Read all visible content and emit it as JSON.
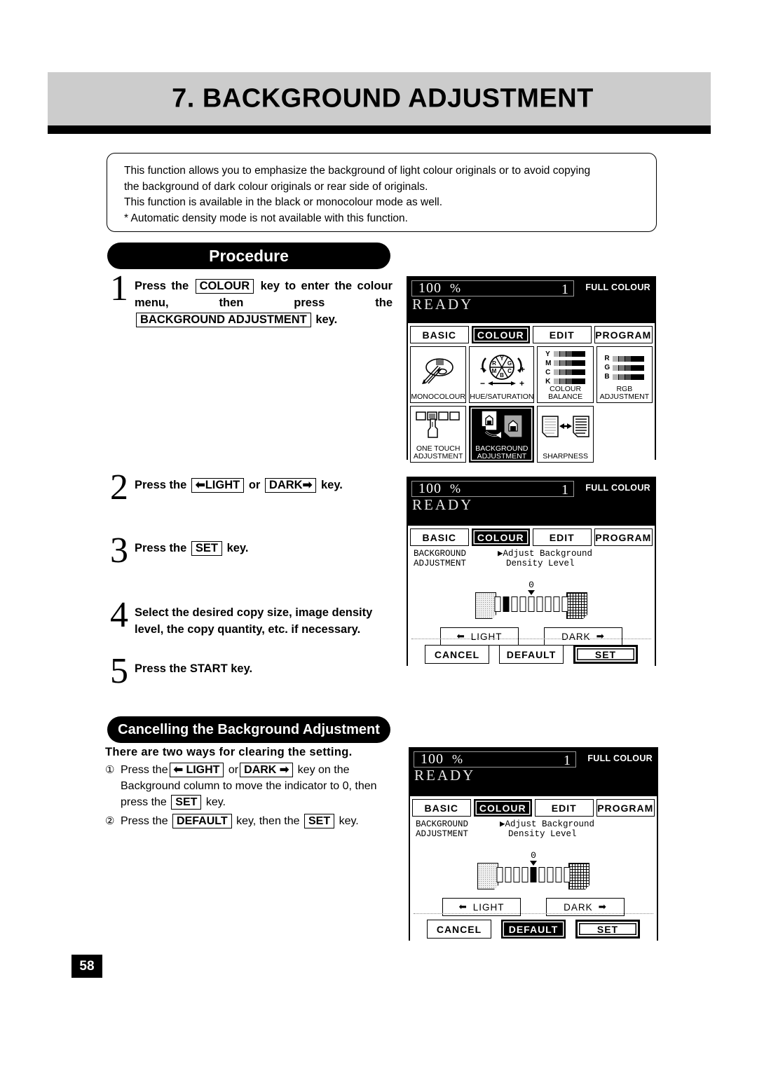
{
  "chapter": {
    "title": "7. BACKGROUND ADJUSTMENT"
  },
  "intro": {
    "line1": "This function allows you to emphasize the background of light colour originals or to avoid copying",
    "line2": "the background of dark colour originals or rear side of originals.",
    "line3": "This function is available in the black or monocolour mode as well.",
    "line4": "* Automatic density mode is not available with this function."
  },
  "headings": {
    "procedure": "Procedure",
    "cancelling": "Cancelling the Background Adjustment"
  },
  "steps": [
    {
      "num": "1",
      "part1": "Press the",
      "key1": "COLOUR",
      "part2": "key to enter the colour menu, then press the",
      "key2": "BACKGROUND ADJUSTMENT",
      "part3": "key."
    },
    {
      "num": "2",
      "part1": "Press the",
      "key1": "LIGHT",
      "part2": "or",
      "key2": "DARK",
      "part3": "key."
    },
    {
      "num": "3",
      "part1": "Press the",
      "key1": "SET",
      "part2": "key."
    },
    {
      "num": "4",
      "part1": "Select the desired copy size, image density level, the copy quantity, etc. if necessary."
    },
    {
      "num": "5",
      "part1": "Press the START key."
    }
  ],
  "cancel": {
    "title": "There are two ways for clearing the setting.",
    "item1": {
      "mark": "①",
      "a": "Press the",
      "key1": "LIGHT",
      "b": "or",
      "key2": "DARK",
      "c": "key on the Background column to move the indicator to 0, then press the",
      "key3": "SET",
      "d": "key."
    },
    "item2": {
      "mark": "②",
      "a": "Press the",
      "key1": "DEFAULT",
      "b": "key, then the",
      "key2": "SET",
      "c": "key."
    }
  },
  "page_number": "58",
  "lcd_common": {
    "zoom_value": "100",
    "zoom_unit": "%",
    "copies": "1",
    "colour_mode": "FULL COLOUR",
    "status": "READY",
    "tabs": [
      {
        "label": "BASIC",
        "selected": false
      },
      {
        "label": "COLOUR",
        "selected": true
      },
      {
        "label": "EDIT",
        "selected": false
      },
      {
        "label": "PROGRAM",
        "selected": false
      }
    ]
  },
  "lcd1": {
    "functions": [
      {
        "label": "MONOCOLOUR",
        "icon": "palette-icon",
        "selected": false
      },
      {
        "label": "HUE/SATURATION",
        "icon": "colour-wheel-icon",
        "selected": false
      },
      {
        "label": "COLOUR BALANCE",
        "icon": "ymck-bars-icon",
        "selected": false
      },
      {
        "label": "RGB\nADJUSTMENT",
        "icon": "rgb-bars-icon",
        "selected": false
      },
      {
        "label": "ONE TOUCH\nADJUSTMENT",
        "icon": "finger-press-icon",
        "selected": false
      },
      {
        "label": "BACKGROUND\nADJUSTMENT",
        "icon": "background-pages-icon",
        "selected": true
      },
      {
        "label": "SHARPNESS",
        "icon": "sharpness-icon",
        "selected": false
      }
    ],
    "ymck_letters": [
      "Y",
      "M",
      "C",
      "K"
    ],
    "rgb_letters": [
      "R",
      "G",
      "B"
    ],
    "wheel_letters": [
      "Y",
      "G",
      "C",
      "B",
      "M",
      "R"
    ]
  },
  "lcd2": {
    "title_line1": "BACKGROUND",
    "title_line2": "ADJUSTMENT",
    "desc_line1": "▶Adjust Background",
    "desc_line2": "Density Level",
    "zero_label": "0",
    "slot_count": 9,
    "active_slot": 2,
    "light_button": "LIGHT",
    "dark_button": "DARK",
    "bottom_buttons": [
      {
        "label": "CANCEL",
        "state": "normal"
      },
      {
        "label": "DEFAULT",
        "state": "normal"
      },
      {
        "label": "SET",
        "state": "emphasized"
      }
    ]
  },
  "lcd3": {
    "title_line1": "BACKGROUND",
    "title_line2": "ADJUSTMENT",
    "desc_line1": "▶Adjust Background",
    "desc_line2": "Density Level",
    "zero_label": "0",
    "slot_count": 9,
    "active_slot": 5,
    "light_button": "LIGHT",
    "dark_button": "DARK",
    "bottom_buttons": [
      {
        "label": "CANCEL",
        "state": "normal"
      },
      {
        "label": "DEFAULT",
        "state": "selected"
      },
      {
        "label": "SET",
        "state": "emphasized"
      }
    ]
  },
  "colors": {
    "header_band": "#cccccc",
    "ink": "#000000",
    "paper": "#ffffff"
  }
}
